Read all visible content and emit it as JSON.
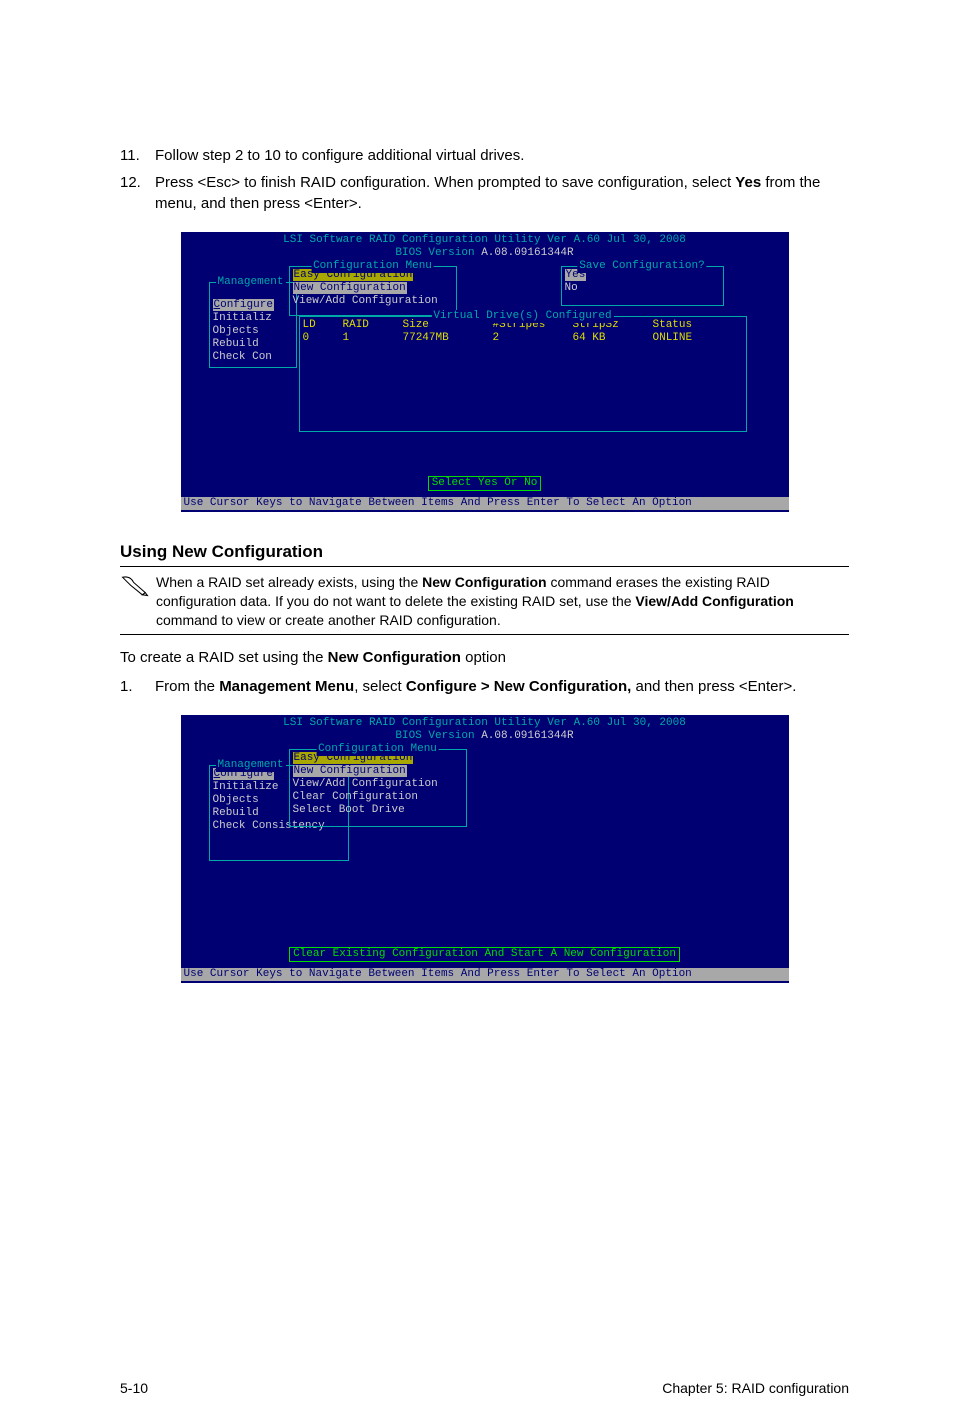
{
  "steps_a": [
    {
      "num": "11.",
      "text": "Follow step 2 to 10 to configure additional virtual drives."
    },
    {
      "num": "12.",
      "text_parts": [
        "Press <Esc> to finish RAID configuration. When prompted to save configuration, select ",
        "Yes",
        " from the menu, and then press <Enter>."
      ]
    }
  ],
  "bios1": {
    "title1": "LSI Software RAID Configuration Utility Ver A.60 Jul 30, 2008",
    "title2_a": "BIOS Version  ",
    "title2_b": "A.08.09161344R",
    "mgmt_label": "Management",
    "mgmt_items": {
      "configure": "Configure",
      "initializ": "Initializ",
      "objects": "Objects",
      "rebuild": "Rebuild",
      "checkcon": "Check Con"
    },
    "conf_label": "Configuration Menu",
    "conf_items": {
      "easy": "Easy Configuration",
      "newc": "New Configuration",
      "viewadd": "View/Add Configuration"
    },
    "save_label": "Save Configuration?",
    "save_yes": "Yes",
    "save_no": "No",
    "vd_label": "Virtual Drive(s) Configured",
    "vd_head": {
      "ld": "LD",
      "raid": "RAID",
      "size": "Size",
      "stripes": "#Stripes",
      "stripsz": "StripSz",
      "status": "Status"
    },
    "vd_row": {
      "ld": "0",
      "raid": "1",
      "size": "77247MB",
      "stripes": "2",
      "stripsz": "64 KB",
      "status": "ONLINE"
    },
    "status": "Select Yes Or No",
    "nav": "Use Cursor Keys to Navigate Between Items And Press Enter To Select An Option"
  },
  "section_head": "Using New Configuration",
  "callout": {
    "parts": [
      "When a RAID set already exists, using the ",
      "New Configuration",
      " command erases the existing RAID configuration data. If you do not want to delete the existing RAID set, use the ",
      "View/Add Configuration",
      " command to view or create another RAID configuration."
    ]
  },
  "intro_b_parts": [
    "To create a RAID set using the ",
    "New Configuration",
    " option"
  ],
  "steps_b": [
    {
      "num": "1.",
      "parts": [
        "From the ",
        "Management Menu",
        ", select ",
        "Configure > New Configuration,",
        " and then press <Enter>."
      ]
    }
  ],
  "bios2": {
    "title1": "LSI Software RAID Configuration Utility Ver A.60 Jul 30, 2008",
    "title2_a": "BIOS Version  ",
    "title2_b": "A.08.09161344R",
    "mgmt_label": "Management",
    "mgmt_items": {
      "configure": "Configure",
      "initialize": "Initialize",
      "objects": "Objects",
      "rebuild": "Rebuild",
      "checkcons": "Check Consistency"
    },
    "conf_label": "Configuration Menu",
    "conf_items": {
      "easy": "Easy Configuration",
      "newc": "New Configuration",
      "viewadd": "View/Add Configuration",
      "clear": "Clear Configuration",
      "selboot": "Select Boot Drive"
    },
    "status": "Clear Existing Configuration And Start A New Configuration",
    "nav": "Use Cursor Keys to Navigate Between Items And Press Enter To Select An Option"
  },
  "footer": {
    "left": "5-10",
    "right": "Chapter 5: RAID configuration"
  }
}
